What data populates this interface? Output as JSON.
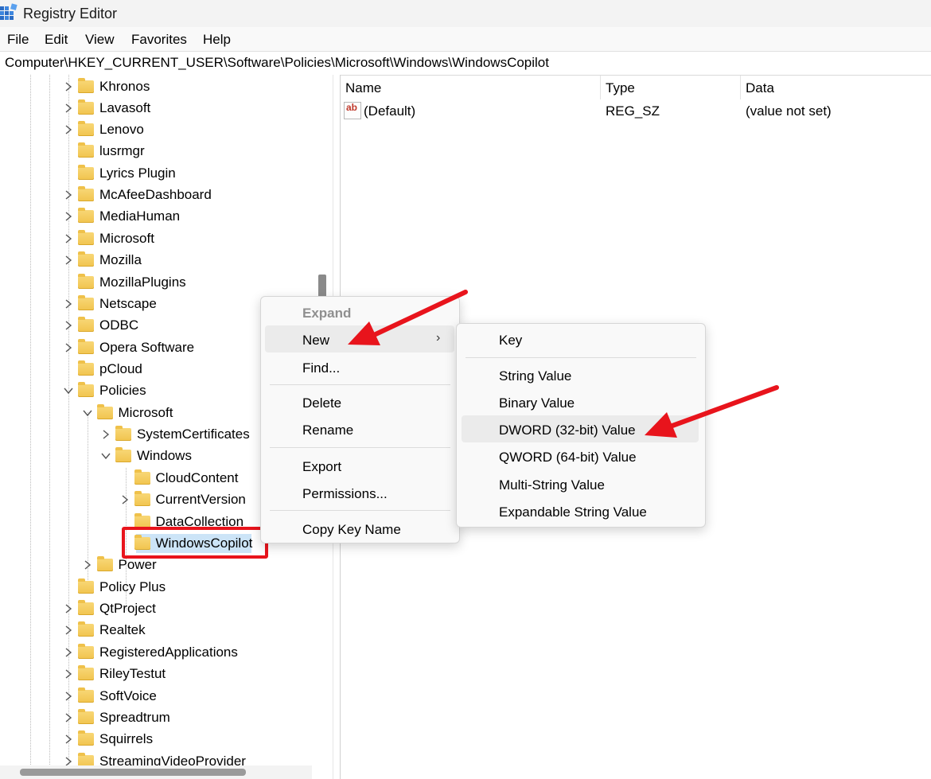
{
  "window": {
    "title": "Registry Editor",
    "icon": "registry-editor-icon"
  },
  "menubar": [
    "File",
    "Edit",
    "View",
    "Favorites",
    "Help"
  ],
  "address": "Computer\\HKEY_CURRENT_USER\\Software\\Policies\\Microsoft\\Windows\\WindowsCopilot",
  "tree": [
    {
      "label": "Khronos",
      "expander": "collapsed"
    },
    {
      "label": "Lavasoft",
      "expander": "collapsed"
    },
    {
      "label": "Lenovo",
      "expander": "collapsed"
    },
    {
      "label": "lusrmgr",
      "expander": "none"
    },
    {
      "label": "Lyrics Plugin",
      "expander": "none"
    },
    {
      "label": "McAfeeDashboard",
      "expander": "collapsed"
    },
    {
      "label": "MediaHuman",
      "expander": "collapsed"
    },
    {
      "label": "Microsoft",
      "expander": "collapsed"
    },
    {
      "label": "Mozilla",
      "expander": "collapsed"
    },
    {
      "label": "MozillaPlugins",
      "expander": "none"
    },
    {
      "label": "Netscape",
      "expander": "collapsed"
    },
    {
      "label": "ODBC",
      "expander": "collapsed"
    },
    {
      "label": "Opera Software",
      "expander": "collapsed"
    },
    {
      "label": "pCloud",
      "expander": "none"
    },
    {
      "label": "Policies",
      "expander": "expanded"
    },
    {
      "label": "Microsoft",
      "expander": "expanded"
    },
    {
      "label": "SystemCertificates",
      "expander": "collapsed"
    },
    {
      "label": "Windows",
      "expander": "expanded"
    },
    {
      "label": "CloudContent",
      "expander": "none"
    },
    {
      "label": "CurrentVersion",
      "expander": "collapsed"
    },
    {
      "label": "DataCollection",
      "expander": "none"
    },
    {
      "label": "WindowsCopilot",
      "expander": "none",
      "selected": true
    },
    {
      "label": "Power",
      "expander": "collapsed"
    },
    {
      "label": "Policy Plus",
      "expander": "none"
    },
    {
      "label": "QtProject",
      "expander": "collapsed"
    },
    {
      "label": "Realtek",
      "expander": "collapsed"
    },
    {
      "label": "RegisteredApplications",
      "expander": "collapsed"
    },
    {
      "label": "RileyTestut",
      "expander": "collapsed"
    },
    {
      "label": "SoftVoice",
      "expander": "collapsed"
    },
    {
      "label": "Spreadtrum",
      "expander": "collapsed"
    },
    {
      "label": "Squirrels",
      "expander": "collapsed"
    },
    {
      "label": "StreamingVideoProvider",
      "expander": "collapsed"
    }
  ],
  "list": {
    "columns": [
      "Name",
      "Type",
      "Data"
    ],
    "rows": [
      {
        "name": "(Default)",
        "type": "REG_SZ",
        "data": "(value not set)",
        "icon": "ab-string-icon",
        "icon_text": "ab"
      }
    ]
  },
  "context_menu": {
    "items": [
      {
        "label": "Expand",
        "state": "disabled"
      },
      {
        "label": "New",
        "state": "hovered",
        "submenu_glyph": "›"
      },
      {
        "label": "Find..."
      },
      {
        "label": "Delete"
      },
      {
        "label": "Rename"
      },
      {
        "label": "Export"
      },
      {
        "label": "Permissions..."
      },
      {
        "label": "Copy Key Name"
      }
    ]
  },
  "submenu": {
    "items": [
      {
        "label": "Key"
      },
      {
        "label": "String Value"
      },
      {
        "label": "Binary Value"
      },
      {
        "label": "DWORD (32-bit) Value",
        "state": "hovered"
      },
      {
        "label": "QWORD (64-bit) Value"
      },
      {
        "label": "Multi-String Value"
      },
      {
        "label": "Expandable String Value"
      }
    ]
  },
  "colors": {
    "annotation": "#e8141c",
    "selection": "#cce4f7",
    "folder": "#f1c44e"
  }
}
